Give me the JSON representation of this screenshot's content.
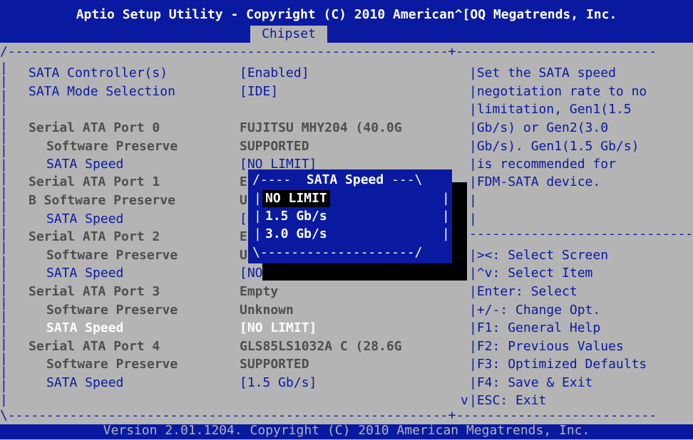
{
  "header": {
    "title": "Aptio Setup Utility - Copyright (C) 2010 American^[OQ Megatrends, Inc.",
    "active_tab": "Chipset"
  },
  "settings": [
    {
      "label": "SATA Controller(s)",
      "value": "[Enabled]"
    },
    {
      "label": "SATA Mode Selection",
      "value": "[IDE]"
    },
    {
      "label": "Serial ATA Port 0",
      "value": "FUJITSU MHY204 (40.0G"
    },
    {
      "label": "Software Preserve",
      "value": "SUPPORTED"
    },
    {
      "label": "SATA Speed",
      "value": "[NO LIMIT]"
    },
    {
      "label": "Serial ATA Port 1",
      "value": "E"
    },
    {
      "label": "B Software Preserve",
      "value": "U"
    },
    {
      "label": "SATA Speed",
      "value": "["
    },
    {
      "label": "Serial ATA Port 2",
      "value": "E"
    },
    {
      "label": "Software Preserve",
      "value": "U"
    },
    {
      "label": "SATA Speed",
      "value": "[NO"
    },
    {
      "label": "Serial ATA Port 3",
      "value": "Empty"
    },
    {
      "label": "Software Preserve",
      "value": "Unknown"
    },
    {
      "label": "SATA Speed",
      "value": "[NO LIMIT]"
    },
    {
      "label": "Serial ATA Port 4",
      "value": "GLS85LS1032A C (28.6G"
    },
    {
      "label": "Software Preserve",
      "value": "SUPPORTED"
    },
    {
      "label": "SATA Speed",
      "value": "[1.5 Gb/s]"
    }
  ],
  "help_text": [
    "Set the SATA speed",
    "negotiation rate to no",
    "limitation, Gen1(1.5",
    "Gb/s) or Gen2(3.0",
    "Gb/s). Gen1(1.5 Gb/s)",
    "is recommended for",
    "FDM-SATA device."
  ],
  "key_help": [
    "><: Select Screen",
    "^v: Select Item",
    "Enter: Select",
    "+/-: Change Opt.",
    "F1: General Help",
    "F2: Previous Values",
    "F3: Optimized Defaults",
    "F4: Save & Exit",
    "ESC: Exit"
  ],
  "scroll_indicator": "v",
  "popup": {
    "title": "SATA Speed",
    "options": [
      "NO LIMIT",
      "1.5 Gb/s",
      "3.0 Gb/s"
    ],
    "selected": "NO LIMIT"
  },
  "footer": {
    "text": "Version 2.01.1204. Copyright (C) 2010 American Megatrends, Inc."
  }
}
